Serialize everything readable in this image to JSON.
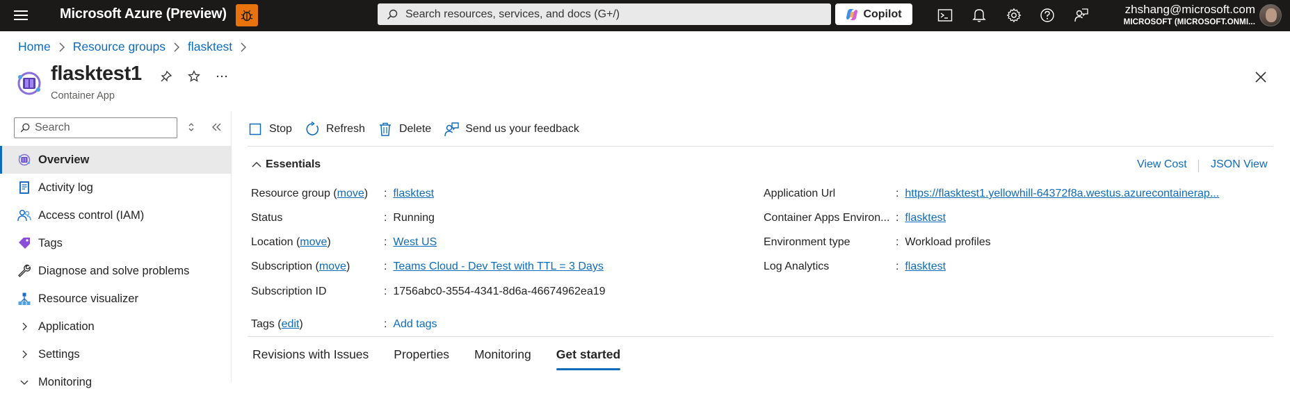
{
  "topbar": {
    "brand": "Microsoft Azure (Preview)",
    "search_placeholder": "Search resources, services, and docs (G+/)",
    "copilot_label": "Copilot",
    "account_email": "zhshang@microsoft.com",
    "account_tenant": "MICROSOFT (MICROSOFT.ONMI..."
  },
  "breadcrumb": [
    "Home",
    "Resource groups",
    "flasktest"
  ],
  "resource": {
    "name": "flasktest1",
    "type": "Container App"
  },
  "sidebar": {
    "search_placeholder": "Search",
    "items": [
      {
        "label": "Overview",
        "icon": "container-app-icon"
      },
      {
        "label": "Activity log",
        "icon": "activity-log-icon"
      },
      {
        "label": "Access control (IAM)",
        "icon": "people-icon"
      },
      {
        "label": "Tags",
        "icon": "tag-icon"
      },
      {
        "label": "Diagnose and solve problems",
        "icon": "wrench-icon"
      },
      {
        "label": "Resource visualizer",
        "icon": "visualizer-icon"
      },
      {
        "label": "Application",
        "icon": "chevron-right-icon"
      },
      {
        "label": "Settings",
        "icon": "chevron-right-icon"
      },
      {
        "label": "Monitoring",
        "icon": "chevron-down-icon"
      }
    ]
  },
  "commands": {
    "stop": "Stop",
    "refresh": "Refresh",
    "delete": "Delete",
    "feedback": "Send us your feedback"
  },
  "essentials": {
    "title": "Essentials",
    "view_cost": "View Cost",
    "json_view": "JSON View",
    "left": {
      "resource_group_label": "Resource group",
      "resource_group_move": "move",
      "resource_group_value": "flasktest",
      "status_label": "Status",
      "status_value": "Running",
      "location_label": "Location",
      "location_move": "move",
      "location_value": "West US",
      "subscription_label": "Subscription",
      "subscription_move": "move",
      "subscription_value": "Teams Cloud - Dev Test with TTL = 3 Days",
      "subscription_id_label": "Subscription ID",
      "subscription_id_value": "1756abc0-3554-4341-8d6a-46674962ea19",
      "tags_label": "Tags",
      "tags_edit": "edit",
      "tags_value": "Add tags"
    },
    "right": {
      "app_url_label": "Application Url",
      "app_url_value": "https://flasktest1.yellowhill-64372f8a.westus.azurecontainerap...",
      "env_label": "Container Apps Environ...",
      "env_value": "flasktest",
      "env_type_label": "Environment type",
      "env_type_value": "Workload profiles",
      "log_label": "Log Analytics",
      "log_value": "flasktest"
    }
  },
  "tabs": [
    {
      "label": "Revisions with Issues",
      "active": false
    },
    {
      "label": "Properties",
      "active": false
    },
    {
      "label": "Monitoring",
      "active": false
    },
    {
      "label": "Get started",
      "active": true
    }
  ],
  "colors": {
    "topbar_bg": "#1b1a19",
    "accent": "#0f6cbd",
    "bug_button": "#e8730c"
  }
}
